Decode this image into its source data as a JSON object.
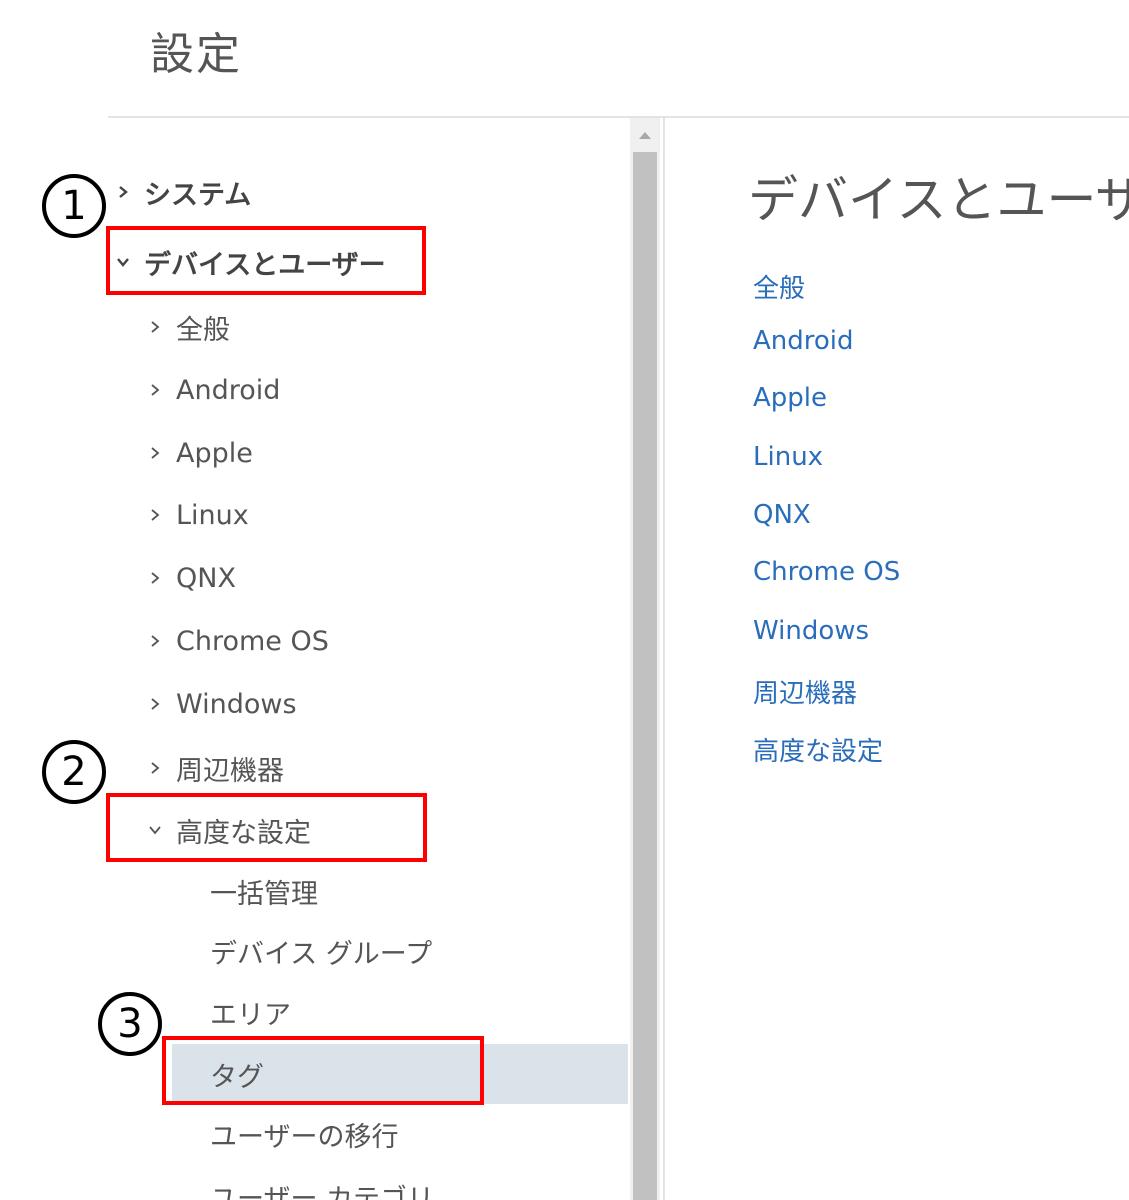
{
  "page": {
    "title": "設定"
  },
  "nav": {
    "top_items": [
      {
        "label": "システム",
        "expanded": false
      },
      {
        "label": "デバイスとユーザー",
        "expanded": true
      }
    ],
    "device_children": [
      {
        "label": "全般"
      },
      {
        "label": "Android"
      },
      {
        "label": "Apple"
      },
      {
        "label": "Linux"
      },
      {
        "label": "QNX"
      },
      {
        "label": "Chrome OS"
      },
      {
        "label": "Windows"
      },
      {
        "label": "周辺機器"
      },
      {
        "label": "高度な設定",
        "expanded": true
      }
    ],
    "advanced_children": [
      {
        "label": "一括管理"
      },
      {
        "label": "デバイス グループ"
      },
      {
        "label": "エリア"
      },
      {
        "label": "タグ",
        "selected": true
      },
      {
        "label": "ユーザーの移行"
      },
      {
        "label": "ユーザー カテゴリ"
      }
    ]
  },
  "content": {
    "title": "デバイスとユーザー",
    "links": [
      "全般",
      "Android",
      "Apple",
      "Linux",
      "QNX",
      "Chrome OS",
      "Windows",
      "周辺機器",
      "高度な設定"
    ]
  },
  "callouts": [
    {
      "number": "1"
    },
    {
      "number": "2"
    },
    {
      "number": "3"
    }
  ],
  "colors": {
    "accent_link": "#2a6ebb",
    "highlight_box": "#ff0000",
    "selected_bg": "#dbe3ea"
  }
}
